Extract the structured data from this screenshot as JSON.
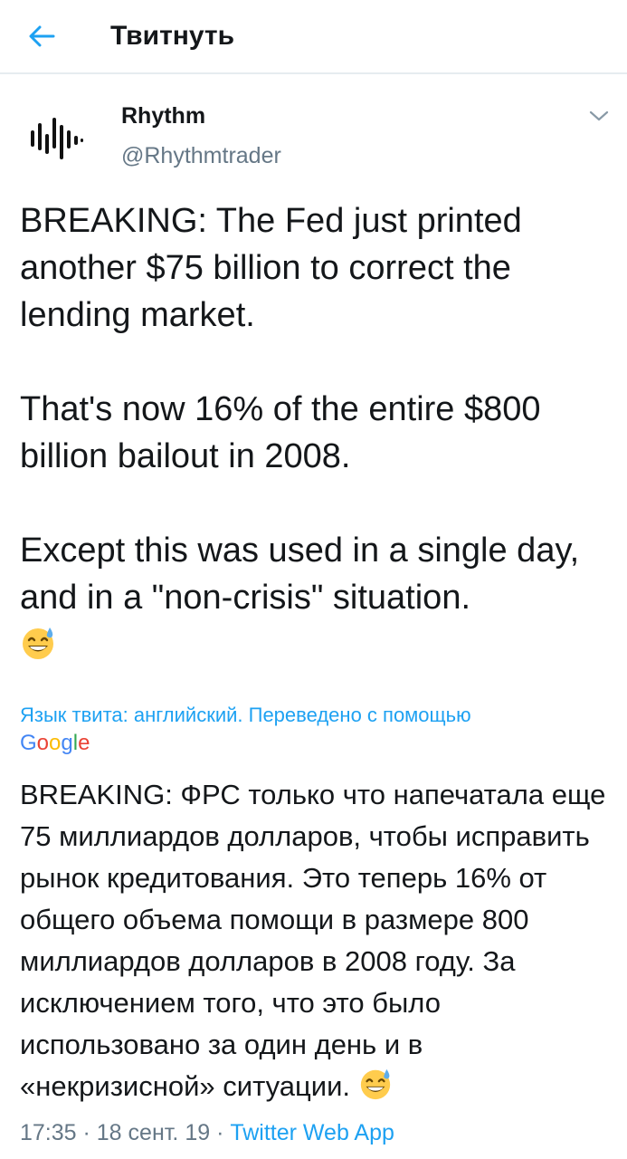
{
  "header": {
    "title": "Твитнуть"
  },
  "tweet": {
    "author_name": "Rhythm",
    "author_handle": "@Rhythmtrader",
    "paragraphs": [
      "BREAKING: The Fed just printed another $75 billion to correct the lending market.",
      "That's now 16% of the entire $800 billion bailout in 2008.",
      "Except this was used in a single day, and in a \"non-crisis\" situation."
    ],
    "emoji": "sweat-smile-emoji"
  },
  "translation": {
    "note": "Язык твита: английский. Переведено с помощью",
    "provider": "Google",
    "text": "BREAKING: ФРС только что напечатала еще 75 миллиардов долларов, чтобы исправить рынок кредитования. Это теперь 16% от общего объема помощи в размере 800 миллиардов долларов в 2008 году. За исключением того, что это было использовано за один день и в «некризисной» ситуации."
  },
  "meta": {
    "time": "17:35",
    "date": "18 сент. 19",
    "separator": " · ",
    "source": "Twitter Web App"
  },
  "colors": {
    "link": "#1da1f2",
    "secondary": "#657786",
    "text": "#14171a"
  }
}
